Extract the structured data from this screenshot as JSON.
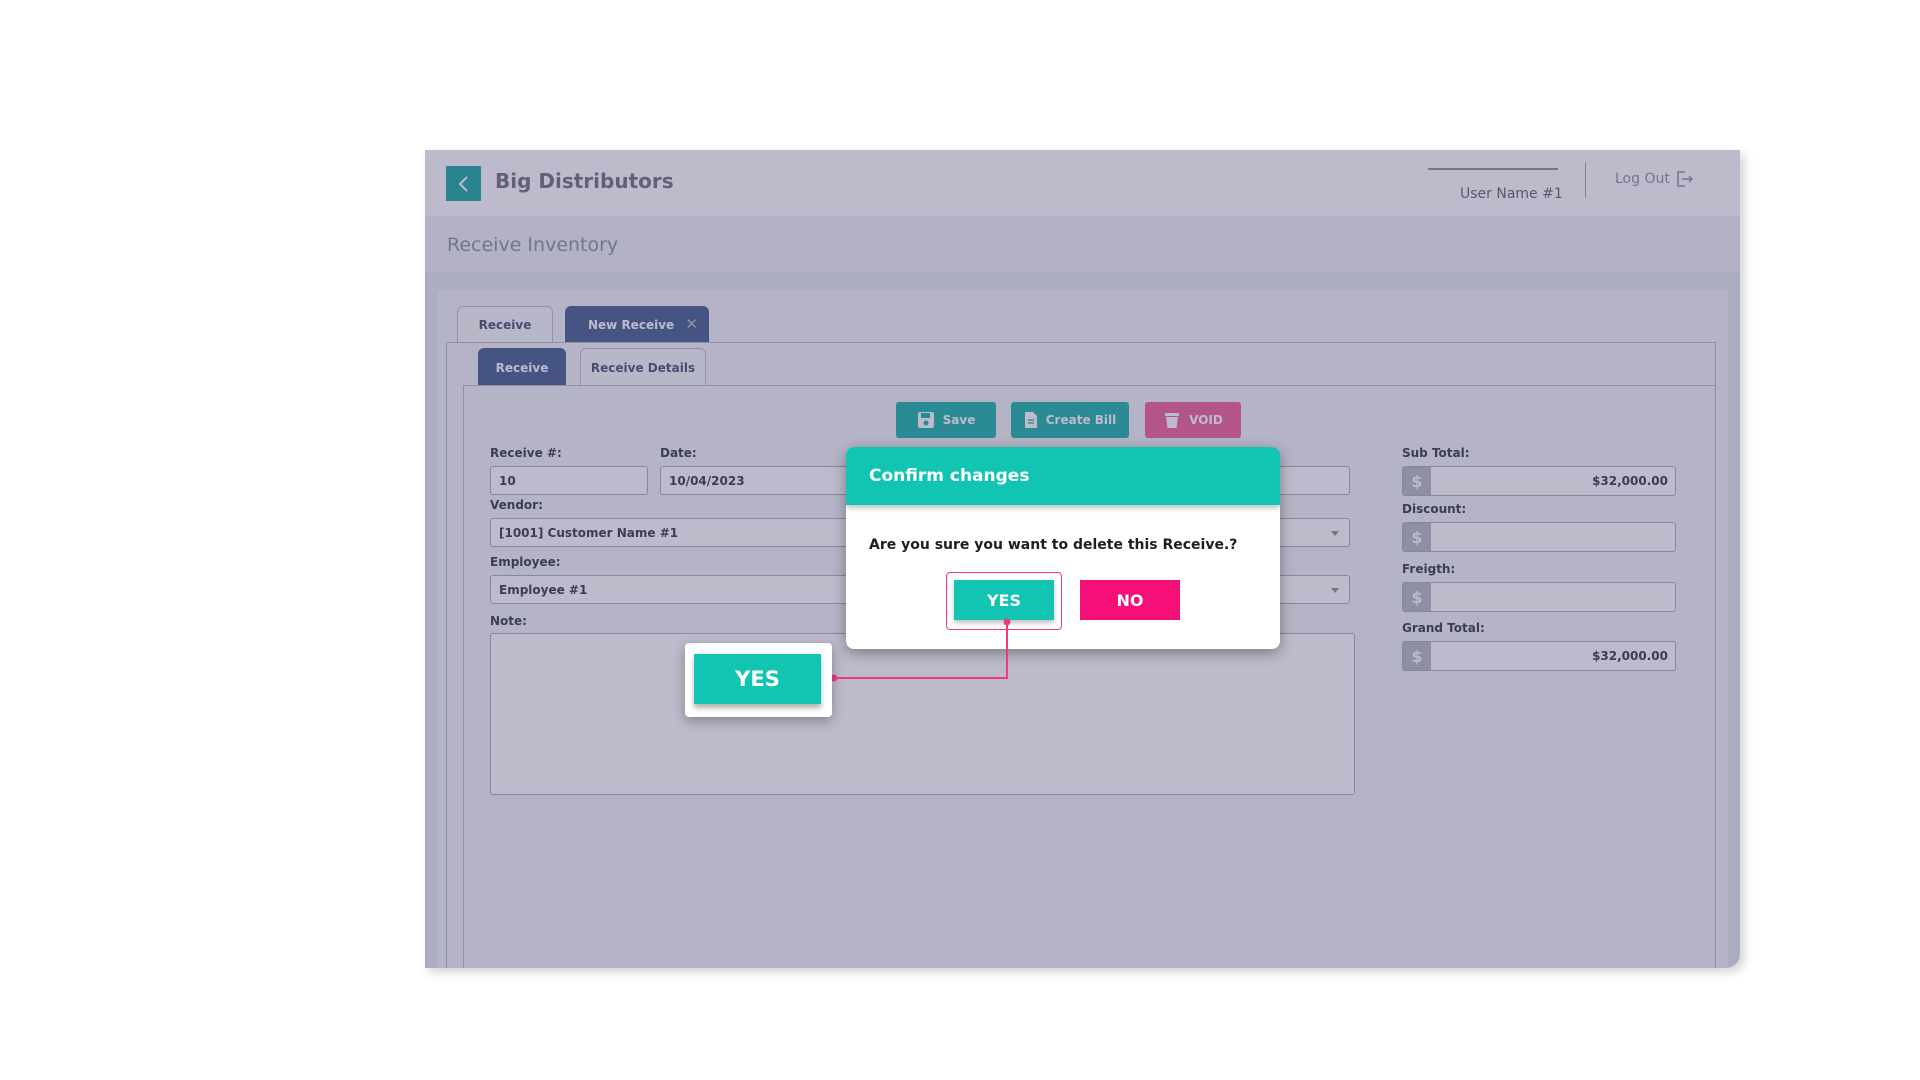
{
  "header": {
    "app_name": "Big Distributors",
    "user_name": "User Name #1",
    "logout_label": "Log Out"
  },
  "page": {
    "title": "Receive Inventory"
  },
  "tabs": [
    {
      "label": "Receive"
    },
    {
      "label": "New Receive"
    }
  ],
  "subtabs": [
    {
      "label": "Receive"
    },
    {
      "label": "Receive Details"
    }
  ],
  "toolbar": {
    "save_label": "Save",
    "create_bill_label": "Create Bill",
    "void_label": "VOID"
  },
  "form": {
    "receive_no_label": "Receive #:",
    "receive_no_value": "10",
    "date_label": "Date:",
    "date_value": "10/04/2023",
    "vendor_label": "Vendor:",
    "vendor_value": "[1001] Customer Name #1",
    "employee_label": "Employee:",
    "employee_value": "Employee #1",
    "note_label": "Note:"
  },
  "totals": {
    "sub_total_label": "Sub Total:",
    "sub_total_value": "$32,000.00",
    "discount_label": "Discount:",
    "discount_value": "",
    "freight_label": "Freigth:",
    "freight_value": "",
    "grand_total_label": "Grand Total:",
    "grand_total_value": "$32,000.00",
    "currency_symbol": "$"
  },
  "dialog": {
    "title": "Confirm changes",
    "message": "Are you sure you want to delete this Receive.?",
    "yes_label": "YES",
    "no_label": "NO"
  },
  "callout": {
    "label": "YES"
  },
  "colors": {
    "teal": "#12c4b2",
    "pink": "#f50f78",
    "navy": "#3e5a8c",
    "overlay": "#524d76"
  }
}
